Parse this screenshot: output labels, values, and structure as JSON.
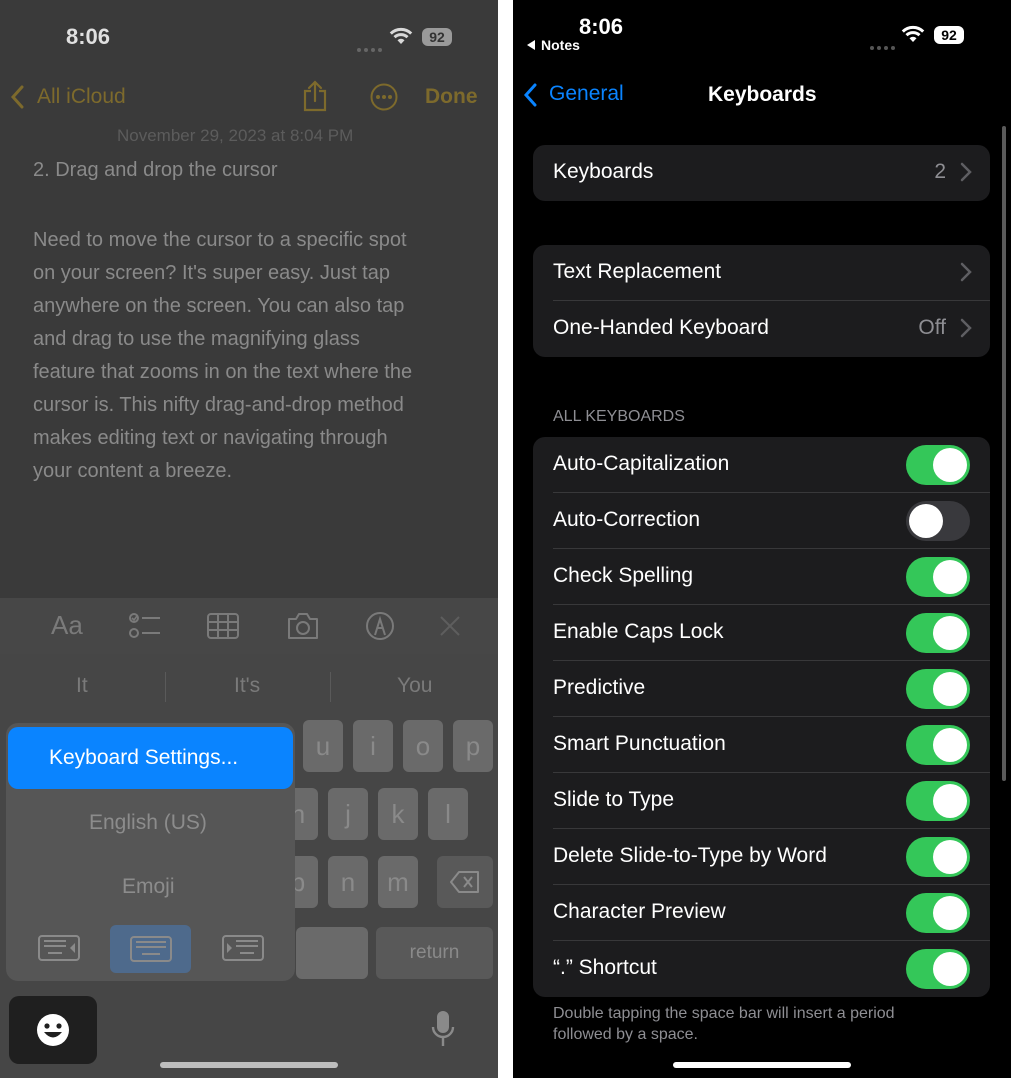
{
  "left": {
    "status": {
      "time": "8:06",
      "battery": "92"
    },
    "nav": {
      "back_label": "All iCloud",
      "done_label": "Done"
    },
    "note": {
      "date": "November 29, 2023 at 8:04 PM",
      "heading": "2. Drag and drop the cursor",
      "body_lines": [
        "Need to move the cursor to a specific spot",
        "on your screen? It's super easy. Just tap",
        "anywhere on the screen. You can also tap",
        "and drag to use the magnifying glass",
        "feature that zooms in on the text where the",
        "cursor is. This nifty drag-and-drop method",
        "makes editing text or navigating through",
        "your content a breeze."
      ]
    },
    "toolbar": {
      "format_label": "Aa"
    },
    "predictions": [
      "It",
      "It's",
      "You"
    ],
    "keys": {
      "row1": [
        "u",
        "i",
        "o",
        "p"
      ],
      "row2": [
        "h",
        "j",
        "k",
        "l"
      ],
      "row3": [
        "b",
        "n",
        "m"
      ],
      "return_label": "return"
    },
    "popup": {
      "settings_label": "Keyboard Settings...",
      "language_label": "English (US)",
      "emoji_label": "Emoji"
    }
  },
  "right": {
    "status": {
      "time": "8:06",
      "back_app": "Notes",
      "battery": "92"
    },
    "nav": {
      "back_label": "General",
      "title": "Keyboards"
    },
    "keyboards_row": {
      "label": "Keyboards",
      "value": "2"
    },
    "text_group": [
      {
        "label": "Text Replacement",
        "value": ""
      },
      {
        "label": "One-Handed Keyboard",
        "value": "Off"
      }
    ],
    "section_header": "ALL KEYBOARDS",
    "toggles": [
      {
        "label": "Auto-Capitalization",
        "on": true
      },
      {
        "label": "Auto-Correction",
        "on": false
      },
      {
        "label": "Check Spelling",
        "on": true
      },
      {
        "label": "Enable Caps Lock",
        "on": true
      },
      {
        "label": "Predictive",
        "on": true
      },
      {
        "label": "Smart Punctuation",
        "on": true
      },
      {
        "label": "Slide to Type",
        "on": true
      },
      {
        "label": "Delete Slide-to-Type by Word",
        "on": true
      },
      {
        "label": "Character Preview",
        "on": true
      },
      {
        "label": "“.” Shortcut",
        "on": true
      }
    ],
    "footer_lines": [
      "Double tapping the space bar will insert a period",
      "followed by a space."
    ]
  },
  "colors": {
    "accent": "#0a84ff",
    "toggle_on": "#34c759",
    "toggle_off": "#39393d",
    "notes_yellow": "#7d6a2c"
  }
}
